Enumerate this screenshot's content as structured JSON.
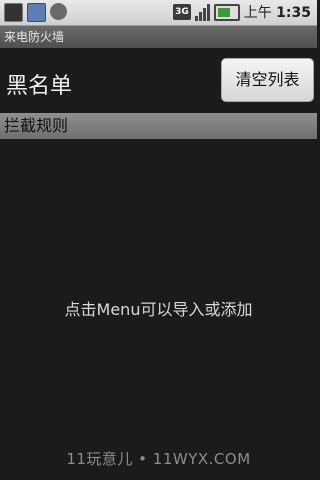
{
  "status_bar": {
    "network": "3G",
    "time_prefix": "上午",
    "time": "1:35"
  },
  "app": {
    "title": "来电防火墙"
  },
  "header": {
    "title": "黑名单",
    "clear_button": "清空列表"
  },
  "section": {
    "label": "拦截规则"
  },
  "empty_hint": "点击Menu可以导入或添加",
  "watermark": "11玩意儿 • 11WYX.COM"
}
